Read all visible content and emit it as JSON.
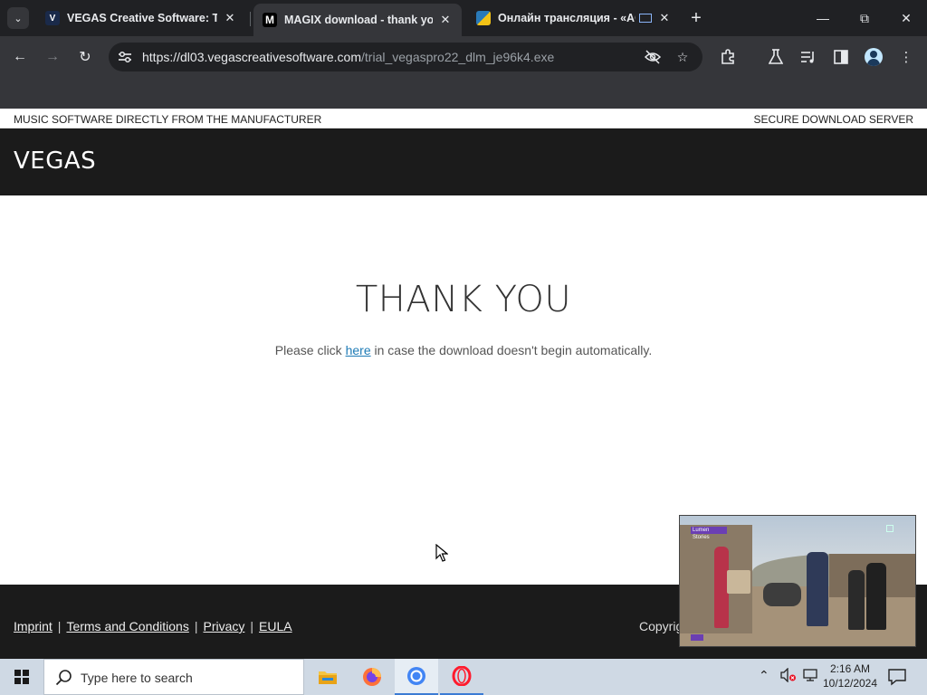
{
  "tabs": [
    {
      "label": "VEGAS Creative Software: The",
      "favicon": "V",
      "favicon_color": "#1a2a4a"
    },
    {
      "label": "MAGIX download - thank you",
      "favicon": "M",
      "favicon_color": "#000000"
    },
    {
      "label": "Онлайн трансляция - «AC",
      "favicon": "",
      "favicon_color": "#2a7ab8"
    }
  ],
  "omnibox": {
    "url_host": "https://dl03.vegascreativesoftware.com",
    "url_path": "/trial_vegaspro22_dlm_je96k4.exe"
  },
  "page": {
    "top_left": "MUSIC SOFTWARE DIRECTLY FROM THE MANUFACTURER",
    "top_right": "SECURE DOWNLOAD SERVER",
    "logo": "VEGAS",
    "heading": "THANK YOU",
    "message_before": "Please click ",
    "message_link": "here",
    "message_after": " in case the download doesn't begin automatically."
  },
  "footer": {
    "links": [
      "Imprint",
      "Terms and Conditions",
      "Privacy",
      "EULA"
    ],
    "copyright": "Copyrig"
  },
  "pip": {
    "badge": "Lumen Stories"
  },
  "taskbar": {
    "search_placeholder": "Type here to search",
    "time": "2:16 AM",
    "date": "10/12/2024"
  },
  "colors": {
    "brand_dark": "#1b1b1b",
    "link": "#1e7bb6",
    "browser_frame": "#202124"
  }
}
